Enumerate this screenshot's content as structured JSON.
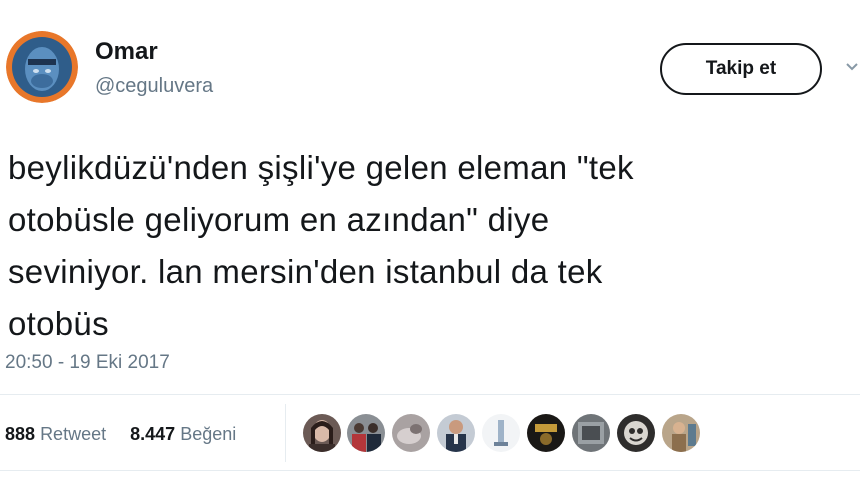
{
  "user": {
    "name": "Omar",
    "handle": "@ceguluvera"
  },
  "follow_button": {
    "label": "Takip et"
  },
  "tweet": {
    "lines": [
      "beylikdüzü'nden şişli'ye gelen eleman \"tek",
      "otobüsle geliyorum en azından\" diye",
      "seviniyor. lan mersin'den istanbul da tek",
      "otobüs"
    ],
    "timestamp": "20:50 - 19 Eki 2017"
  },
  "stats": {
    "retweet_count": "888",
    "retweet_label": "Retweet",
    "like_count": "8.447",
    "like_label": "Beğeni"
  },
  "colors": {
    "text": "#14171a",
    "secondary": "#657786",
    "avatar_bg": "#e8772a"
  },
  "likers": [
    {
      "name": "liker-avatar-1"
    },
    {
      "name": "liker-avatar-2"
    },
    {
      "name": "liker-avatar-3"
    },
    {
      "name": "liker-avatar-4"
    },
    {
      "name": "liker-avatar-5"
    },
    {
      "name": "liker-avatar-6"
    },
    {
      "name": "liker-avatar-7"
    },
    {
      "name": "liker-avatar-8"
    },
    {
      "name": "liker-avatar-9"
    }
  ]
}
